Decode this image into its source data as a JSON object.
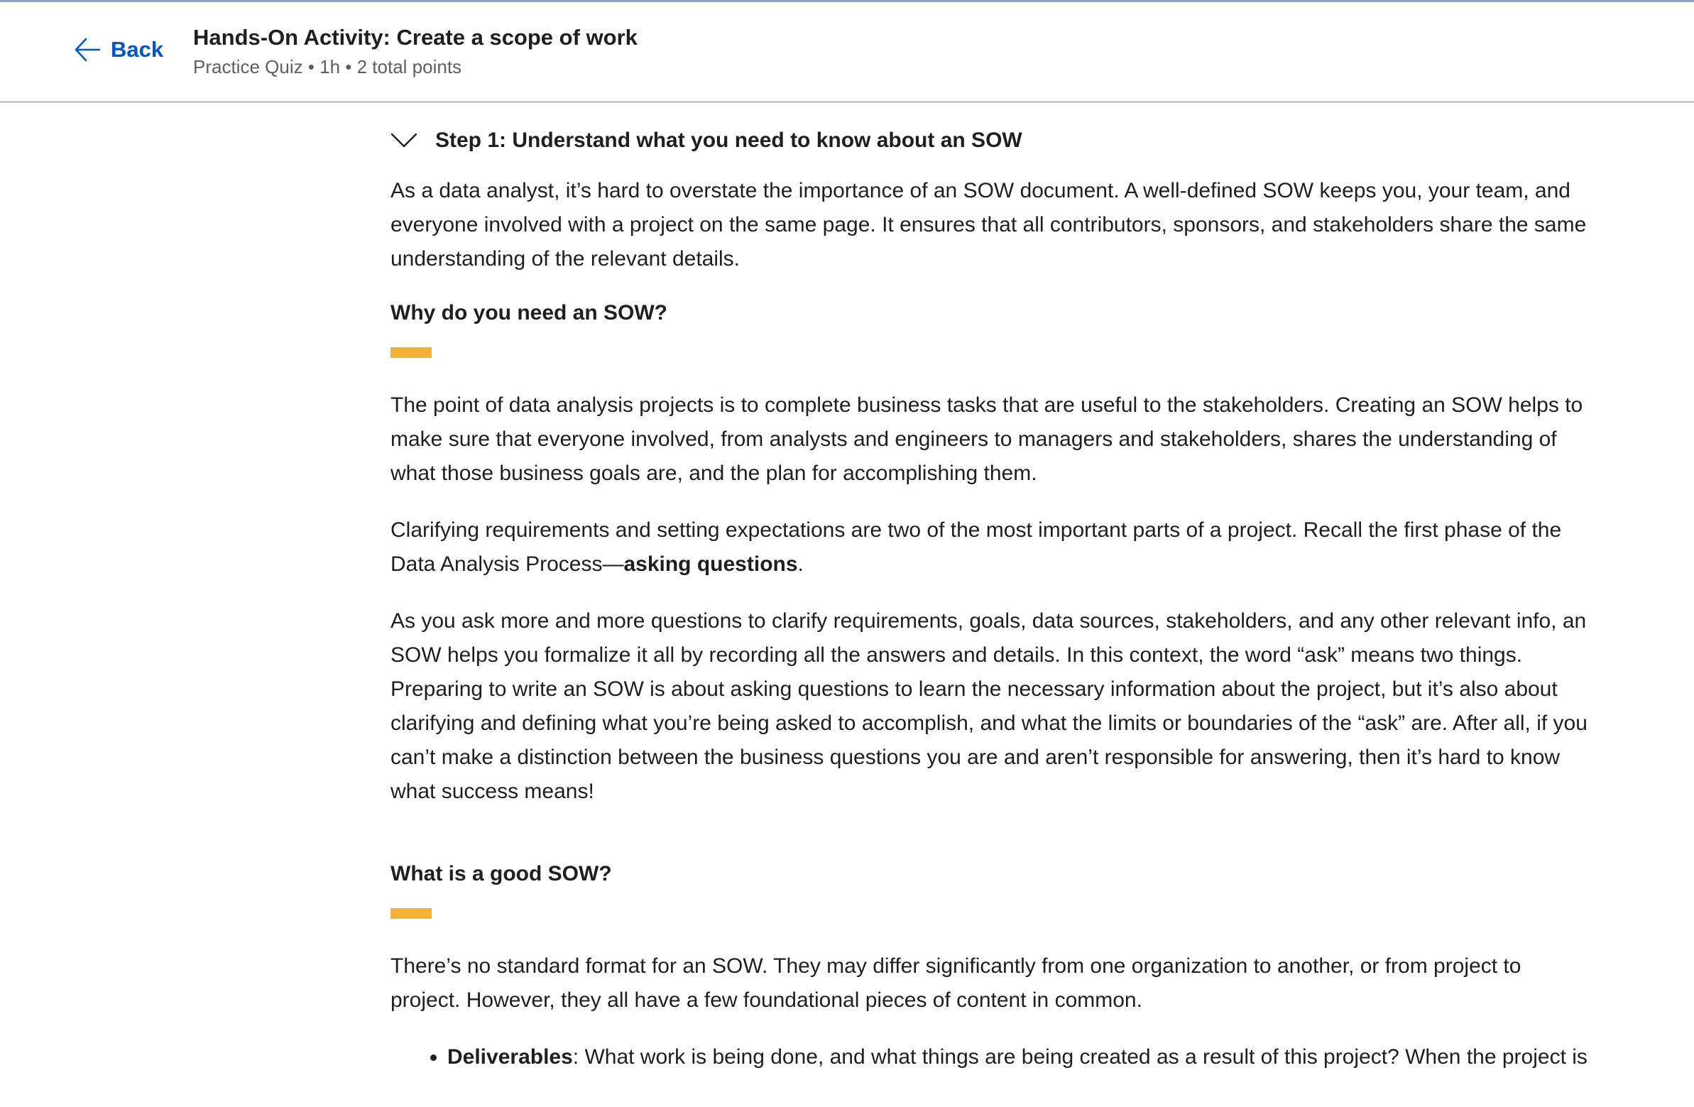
{
  "header": {
    "back_label": "Back",
    "title": "Hands-On Activity: Create a scope of work",
    "subtitle": "Practice Quiz • 1h • 2 total points"
  },
  "step": {
    "title": "Step 1: Understand what you need to know about an SOW"
  },
  "content": {
    "intro": "As a data analyst, it’s hard to overstate the importance of an SOW document. A well-defined SOW keeps you, your team, and everyone involved with a project on the same page. It ensures that all contributors, sponsors, and stakeholders share the same understanding of the relevant details.",
    "section1_heading": "Why do you need an SOW?",
    "p1": "The point of data analysis projects is to complete business tasks that are useful to the stakeholders. Creating an SOW helps to make sure that everyone involved, from analysts and engineers to managers and stakeholders, shares the understanding of what those business goals are, and the plan for accomplishing them.",
    "p2_before": "Clarifying requirements and setting expectations are two of the most important parts of a project. Recall the first phase of the Data Analysis Process—",
    "p2_bold": "asking questions",
    "p2_after": ".",
    "p3": "As you ask more and more questions to clarify requirements, goals, data sources, stakeholders, and any other relevant info, an SOW helps you formalize it all by recording all the answers and details. In this context, the word “ask” means two things. Preparing to write an SOW is about asking questions to learn the necessary information about the project, but it’s also about clarifying and defining what you’re being asked to accomplish, and what the limits or boundaries of the “ask” are. After all, if you can’t make a distinction between the business questions you are and aren’t responsible for answering, then it’s hard to know what success means!",
    "section2_heading": "What is a good SOW?",
    "p4": "There’s no standard format for an SOW. They may differ significantly from one organization to another, or from project to project. However, they all have a few foundational pieces of content in common.",
    "bullet1_bold": "Deliverables",
    "bullet1_text": ": What work is being done, and what things are being created as a result of this project? When the project is"
  },
  "colors": {
    "link": "#0056d2",
    "accent": "#f5b335",
    "text": "#1f1f1f",
    "muted": "#5b6066"
  }
}
